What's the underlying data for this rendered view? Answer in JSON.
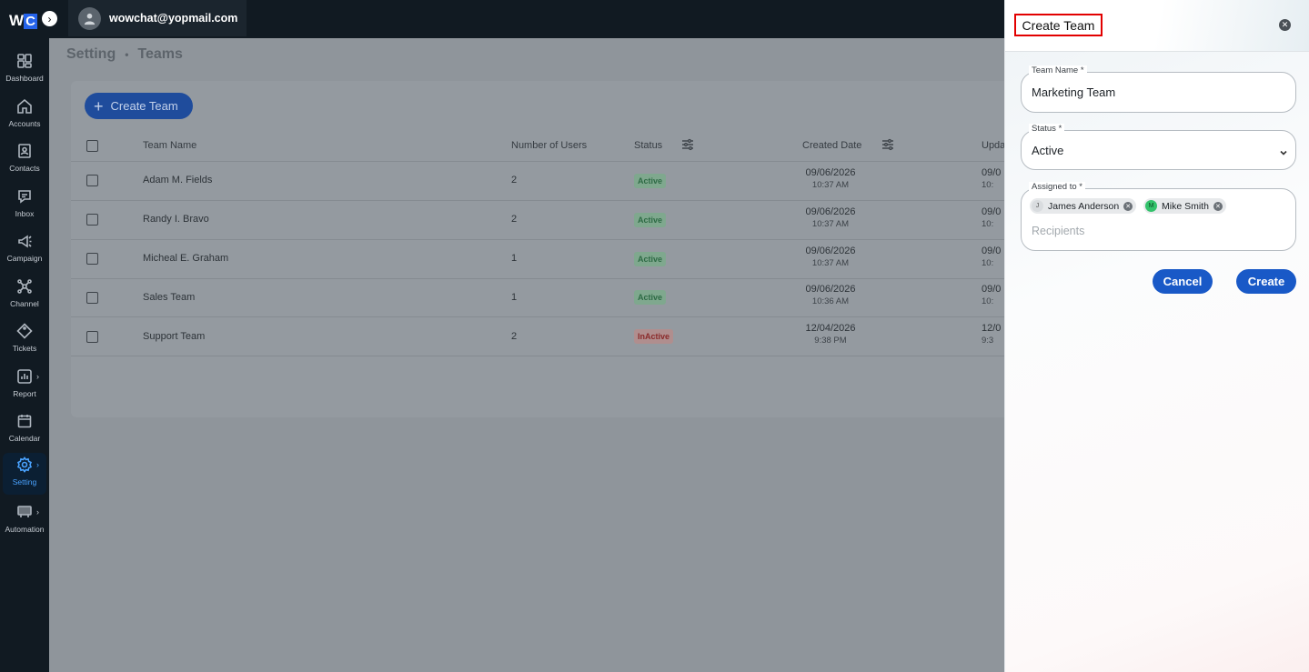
{
  "brand": {
    "logo_w": "W",
    "logo_c": "C"
  },
  "sidebar": {
    "items": [
      {
        "label": "Dashboard",
        "icon": "dashboard-icon"
      },
      {
        "label": "Accounts",
        "icon": "home-icon"
      },
      {
        "label": "Contacts",
        "icon": "contacts-icon"
      },
      {
        "label": "Inbox",
        "icon": "inbox-icon"
      },
      {
        "label": "Campaign",
        "icon": "megaphone-icon"
      },
      {
        "label": "Channel",
        "icon": "channel-icon"
      },
      {
        "label": "Tickets",
        "icon": "ticket-icon"
      },
      {
        "label": "Report",
        "icon": "report-icon"
      },
      {
        "label": "Calendar",
        "icon": "calendar-icon"
      },
      {
        "label": "Setting",
        "icon": "gear-icon"
      },
      {
        "label": "Automation",
        "icon": "automation-icon"
      }
    ]
  },
  "topbar": {
    "email": "wowchat@yopmail.com"
  },
  "breadcrumb": {
    "root": "Setting",
    "separator": "•",
    "current": "Teams"
  },
  "toolbar": {
    "create_label": "Create Team"
  },
  "table": {
    "headers": {
      "name": "Team Name",
      "users": "Number of Users",
      "status": "Status",
      "created": "Created Date",
      "updated": "Upda"
    },
    "rows": [
      {
        "name": "Adam M. Fields",
        "users": "2",
        "status": "Active",
        "created_date": "09/06/2026",
        "created_time": "10:37 AM",
        "updated_date": "09/0",
        "updated_time": "10:"
      },
      {
        "name": "Randy I. Bravo",
        "users": "2",
        "status": "Active",
        "created_date": "09/06/2026",
        "created_time": "10:37 AM",
        "updated_date": "09/0",
        "updated_time": "10:"
      },
      {
        "name": "Micheal E. Graham",
        "users": "1",
        "status": "Active",
        "created_date": "09/06/2026",
        "created_time": "10:37 AM",
        "updated_date": "09/0",
        "updated_time": "10:"
      },
      {
        "name": "Sales Team",
        "users": "1",
        "status": "Active",
        "created_date": "09/06/2026",
        "created_time": "10:36 AM",
        "updated_date": "09/0",
        "updated_time": "10:"
      },
      {
        "name": "Support Team",
        "users": "2",
        "status": "InActive",
        "created_date": "12/04/2026",
        "created_time": "9:38 PM",
        "updated_date": "12/0",
        "updated_time": "9:3"
      }
    ]
  },
  "panel": {
    "title": "Create Team",
    "team_name": {
      "label": "Team Name *",
      "value": "Marketing Team"
    },
    "status": {
      "label": "Status *",
      "value": "Active"
    },
    "assigned": {
      "label": "Assigned to *",
      "chips": [
        {
          "initial": "J",
          "name": "James Anderson",
          "color": "#d9dcdf"
        },
        {
          "initial": "M",
          "name": "Mike Smith",
          "color": "#33c26b"
        }
      ],
      "placeholder": "Recipients"
    },
    "cancel_label": "Cancel",
    "create_label": "Create"
  }
}
